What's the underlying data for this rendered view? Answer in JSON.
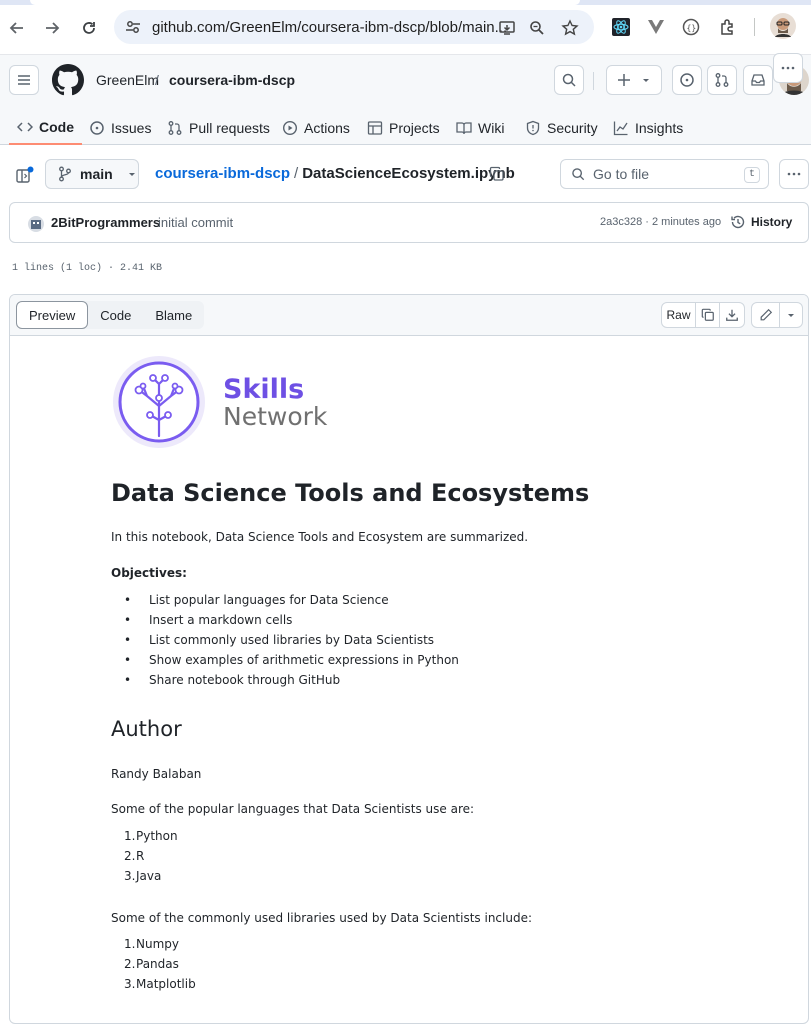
{
  "browser": {
    "url": "github.com/GreenElm/coursera-ibm-dscp/blob/main..."
  },
  "header": {
    "owner": "GreenElm",
    "separator": "/",
    "repo": "coursera-ibm-dscp"
  },
  "repo_tabs": [
    {
      "label": "Code",
      "icon": "code-icon"
    },
    {
      "label": "Issues",
      "icon": "issue-icon"
    },
    {
      "label": "Pull requests",
      "icon": "pull-request-icon"
    },
    {
      "label": "Actions",
      "icon": "play-icon"
    },
    {
      "label": "Projects",
      "icon": "table-icon"
    },
    {
      "label": "Wiki",
      "icon": "book-icon"
    },
    {
      "label": "Security",
      "icon": "shield-icon"
    },
    {
      "label": "Insights",
      "icon": "graph-icon"
    }
  ],
  "file_bar": {
    "branch": "main",
    "repo_link": "coursera-ibm-dscp",
    "path_sep": "/",
    "file_name": "DataScienceEcosystem.ipynb",
    "goto_placeholder": "Go to file",
    "goto_shortcut": "t"
  },
  "commit": {
    "author": "2BitProgrammers",
    "message": "initial commit",
    "meta": "2a3c328 · 2 minutes ago",
    "history_label": "History"
  },
  "file_info": "1 lines (1 loc) · 2.41 KB",
  "file_toolbar": {
    "tabs": [
      "Preview",
      "Code",
      "Blame"
    ],
    "active_tab": "Preview",
    "raw_label": "Raw"
  },
  "notebook": {
    "logo_line1": "Skills",
    "logo_line2": "Network",
    "title": "Data Science Tools and Ecosystems",
    "intro": "In this notebook, Data Science Tools and Ecosystem are summarized.",
    "objectives_label": "Objectives:",
    "objectives": [
      "List popular languages for Data Science",
      "Insert a markdown cells",
      "List commonly used libraries by Data Scientists",
      "Show examples of arithmetic expressions in Python",
      "Share notebook through GitHub"
    ],
    "author_heading": "Author",
    "author_name": "Randy Balaban",
    "languages_intro": "Some of the popular languages that Data Scientists use are:",
    "languages": [
      {
        "num": "1.",
        "name": "Python"
      },
      {
        "num": "2.",
        "name": "R"
      },
      {
        "num": "3.",
        "name": "Java"
      }
    ],
    "libraries_intro": "Some of the commonly used libraries used by Data Scientists include:",
    "libraries": [
      {
        "num": "1.",
        "name": "Numpy"
      },
      {
        "num": "2.",
        "name": "Pandas"
      },
      {
        "num": "3.",
        "name": "Matplotlib"
      }
    ]
  },
  "colors": {
    "accent_link": "#0969da",
    "tab_underline": "#fd8c73",
    "logo_purple": "#6e50e4"
  }
}
